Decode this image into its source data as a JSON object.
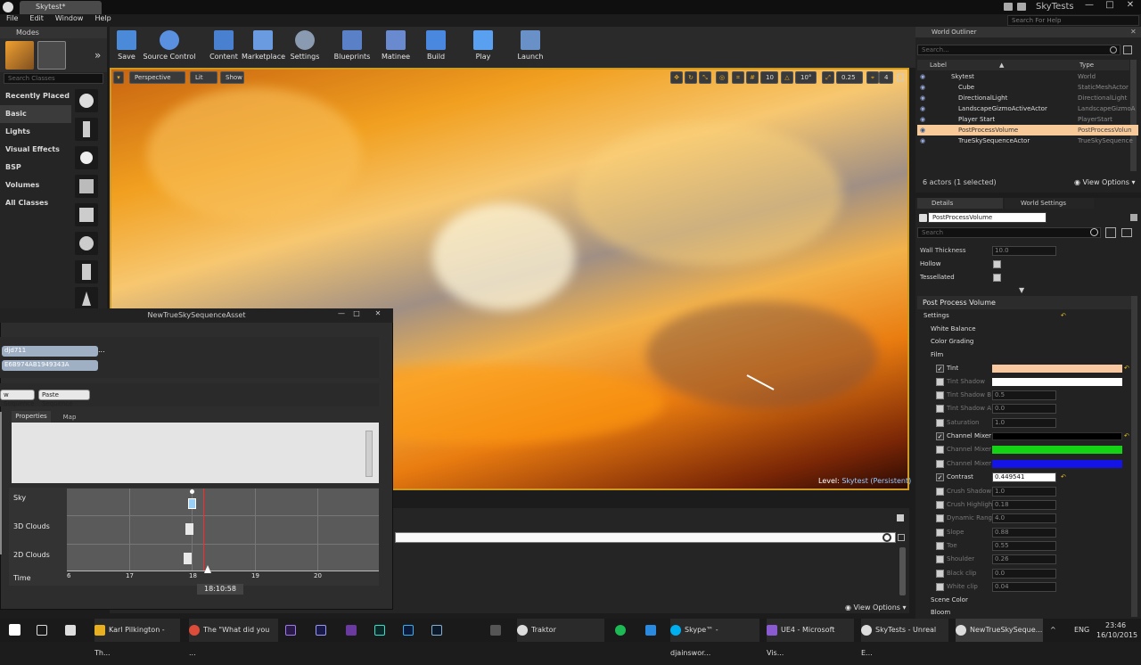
{
  "window": {
    "tab_title": "Skytest*",
    "project": "SkyTests",
    "controls": {
      "min": "—",
      "max": "□",
      "close": "✕"
    }
  },
  "menu": [
    "File",
    "Edit",
    "Window",
    "Help"
  ],
  "help_search": {
    "placeholder": "Search For Help"
  },
  "modes": {
    "title": "Modes",
    "search_placeholder": "Search Classes",
    "categories": [
      "Recently Placed",
      "Basic",
      "Lights",
      "Visual Effects",
      "BSP",
      "Volumes",
      "All Classes"
    ],
    "selected": "Basic"
  },
  "toolbar": [
    "Save",
    "Source Control",
    "Content",
    "Marketplace",
    "Settings",
    "Blueprints",
    "Matinee",
    "Build",
    "Play",
    "Launch"
  ],
  "viewport": {
    "perspective": "Perspective",
    "lit": "Lit",
    "show": "Show",
    "grid_size": "10",
    "rotation_snap": "10°",
    "scale_snap": "0.25",
    "camera_speed": "4",
    "level_label": "Level:",
    "level_name": "Skytest (Persistent)"
  },
  "outliner": {
    "title": "World Outliner",
    "search_placeholder": "Search...",
    "col_label": "Label",
    "col_type": "Type",
    "rows": [
      {
        "label": "Skytest",
        "type": "World"
      },
      {
        "label": "Cube",
        "type": "StaticMeshActor"
      },
      {
        "label": "DirectionalLight",
        "type": "DirectionalLight"
      },
      {
        "label": "LandscapeGizmoActiveActor",
        "type": "LandscapeGizmoA"
      },
      {
        "label": "Player Start",
        "type": "PlayerStart"
      },
      {
        "label": "PostProcessVolume",
        "type": "PostProcessVolun"
      },
      {
        "label": "TrueSkySequenceActor",
        "type": "TrueSkySequence"
      }
    ],
    "selected": "PostProcessVolume",
    "footer": "6 actors (1 selected)",
    "view_options": "View Options"
  },
  "details": {
    "tab_details": "Details",
    "tab_world": "World Settings",
    "object_name": "PostProcessVolume",
    "search_placeholder": "Search",
    "top_props": [
      {
        "label": "Wall Thickness",
        "value": "10.0"
      },
      {
        "label": "Hollow",
        "value": ""
      },
      {
        "label": "Tessellated",
        "value": ""
      }
    ],
    "section": "Post Process Volume",
    "settings": "Settings",
    "groups": [
      "White Balance",
      "Color Grading",
      "Film"
    ],
    "film_props": [
      {
        "label": "Tint",
        "value": "",
        "checked": true,
        "color": "#f8c8a0"
      },
      {
        "label": "Tint Shadow",
        "value": "",
        "checked": false,
        "color": "#ffffff"
      },
      {
        "label": "Tint Shadow B",
        "value": "0.5",
        "checked": false
      },
      {
        "label": "Tint Shadow A",
        "value": "0.0",
        "checked": false
      },
      {
        "label": "Saturation",
        "value": "1.0",
        "checked": false
      },
      {
        "label": "Channel Mixer",
        "value": "",
        "checked": true,
        "color": "#000000"
      },
      {
        "label": "Channel Mixer",
        "value": "",
        "checked": false,
        "color": "#14d214"
      },
      {
        "label": "Channel Mixer",
        "value": "",
        "checked": false,
        "color": "#1414e6"
      },
      {
        "label": "Contrast",
        "value": "0.449541",
        "checked": true
      },
      {
        "label": "Crush Shadow",
        "value": "1.0",
        "checked": false
      },
      {
        "label": "Crush Highligh",
        "value": "0.18",
        "checked": false
      },
      {
        "label": "Dynamic Rang",
        "value": "4.0",
        "checked": false
      },
      {
        "label": "Slope",
        "value": "0.88",
        "checked": false
      },
      {
        "label": "Toe",
        "value": "0.55",
        "checked": false
      },
      {
        "label": "Shoulder",
        "value": "0.26",
        "checked": false
      },
      {
        "label": "Black clip",
        "value": "0.0",
        "checked": false
      },
      {
        "label": "White clip",
        "value": "0.04",
        "checked": false
      }
    ],
    "tail_groups": [
      "Scene Color",
      "Bloom"
    ],
    "view_options": "View Options"
  },
  "sequence": {
    "title": "NewTrueSkySequenceAsset",
    "field1": "djd711",
    "field2": "E6B974AB1949343A",
    "btn_new": "w Sequence",
    "btn_paste": "Paste Sequence",
    "tab_properties": "Properties",
    "tab_map": "Map",
    "tracks": [
      "Sky",
      "3D Clouds",
      "2D Clouds"
    ],
    "time_label": "Time",
    "ticks": [
      "6",
      "17",
      "18",
      "19",
      "20"
    ],
    "cursor_time": "18:10:58"
  },
  "taskbar": {
    "items": [
      "Karl Pilkington - Th...",
      "The \"What did you ...",
      "Traktor",
      "Skype™ - djainswor...",
      "UE4 - Microsoft Vis...",
      "SkyTests - Unreal E...",
      "NewTrueSkySeque..."
    ],
    "lang": "ENG",
    "time": "23:46",
    "date": "16/10/2015"
  }
}
